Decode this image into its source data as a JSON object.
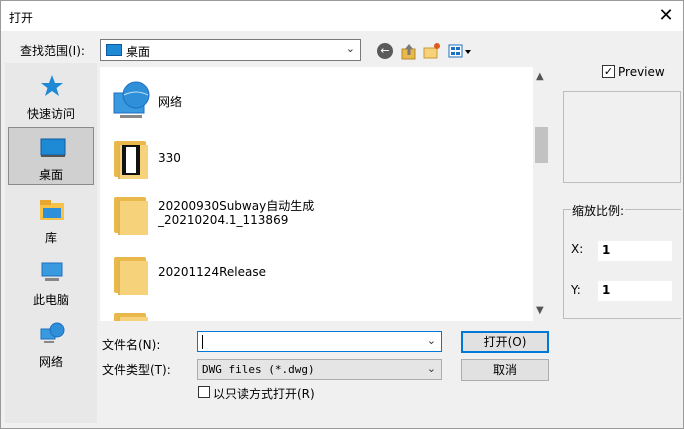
{
  "window": {
    "title": "打开",
    "close": "✕"
  },
  "toolbar": {
    "lookin_label": "查找范围(I):",
    "lookin_value": "桌面"
  },
  "places": [
    {
      "label": "快速访问",
      "icon": "star-icon"
    },
    {
      "label": "桌面",
      "icon": "desktop-icon",
      "selected": true
    },
    {
      "label": "库",
      "icon": "library-icon"
    },
    {
      "label": "此电脑",
      "icon": "computer-icon"
    },
    {
      "label": "网络",
      "icon": "network-icon"
    }
  ],
  "files": [
    {
      "name": "网络",
      "icon": "network-globe-icon"
    },
    {
      "name": "330",
      "icon": "folder-icon"
    },
    {
      "name_line1": "20200930Subway自动生成",
      "name_line2": "_20210204.1_113869",
      "icon": "folder-icon"
    },
    {
      "name": "20201124Release",
      "icon": "folder-icon"
    }
  ],
  "form": {
    "filename_label": "文件名(N):",
    "filename_value": "",
    "filetype_label": "文件类型(T):",
    "filetype_value": "DWG files (*.dwg)",
    "readonly_label": "以只读方式打开(R)"
  },
  "buttons": {
    "open": "打开(O)",
    "cancel": "取消"
  },
  "preview": {
    "label": "Preview",
    "checked": true,
    "zoom_label": "缩放比例:",
    "x_label": "X:",
    "x_value": "1",
    "y_label": "Y:",
    "y_value": "1"
  },
  "colors": {
    "accent": "#0078d7",
    "folder": "#f6d27a"
  }
}
